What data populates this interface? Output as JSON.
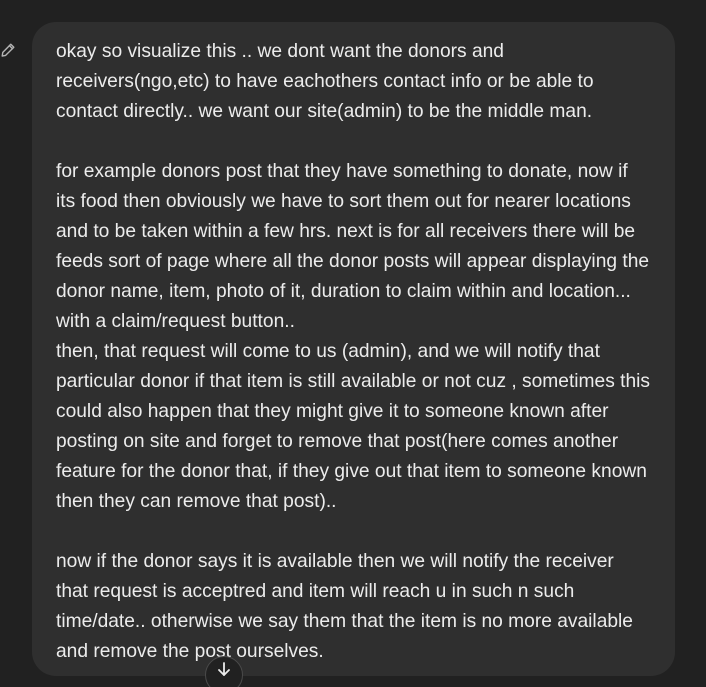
{
  "message": {
    "paragraphs": [
      "okay so visualize this .. we dont want the donors and receivers(ngo,etc) to have eachothers contact info or be able to contact directly.. we want our site(admin) to be the middle man.",
      "for example donors post that they have something to donate, now if its food then obviously we have to sort them out for nearer locations and to be taken within a few hrs. next is for all receivers there will be feeds sort of page where all the donor posts will appear displaying the donor name, item, photo of it, duration to claim within and location... with a claim/request button..\nthen, that request will come to us (admin), and we will notify that particular donor if that item is still available or not cuz , sometimes this could also happen that they might give it to someone known after posting on site and forget to remove that post(here comes another feature for the donor that, if they give out that item to someone known then they can remove that post)..",
      "now if the donor says it is available then we will notify the receiver that request is acceptred and item will reach u in such n such time/date.. otherwise we say them that the item is no more available and remove the post ourselves."
    ]
  },
  "icons": {
    "edit": "pencil-icon",
    "scroll": "arrow-down-icon"
  },
  "colors": {
    "background": "#212121",
    "bubble": "#2f2f2f",
    "text": "#ececec",
    "icon": "#b4b4b4"
  }
}
